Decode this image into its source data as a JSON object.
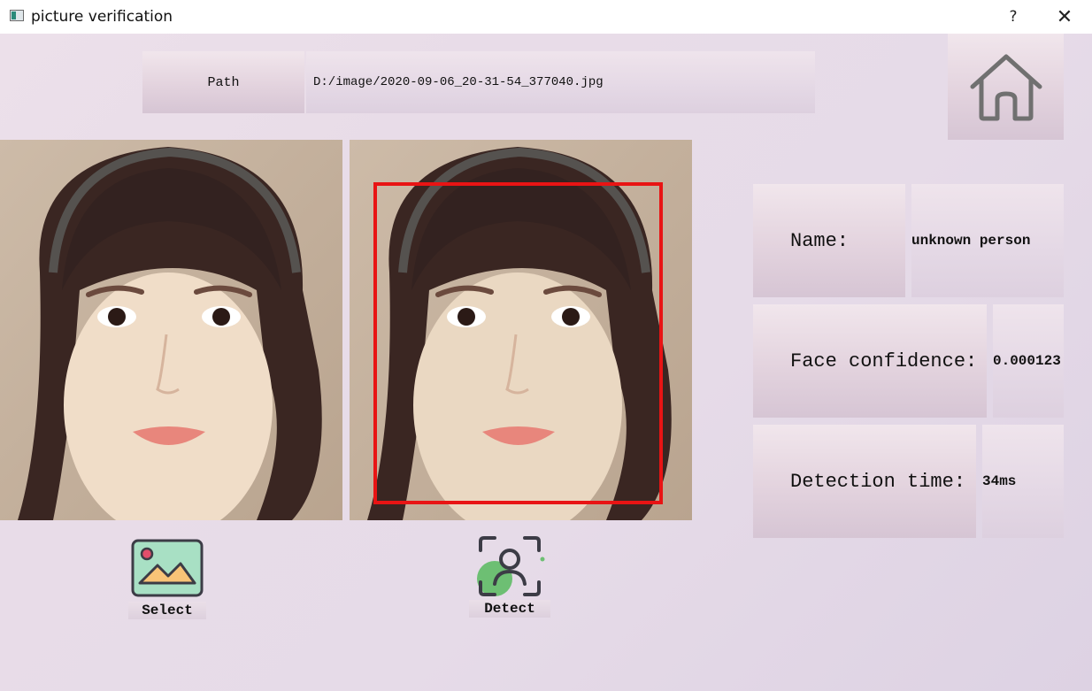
{
  "window": {
    "title": "picture verification",
    "help_label": "?",
    "close_label": "✕"
  },
  "path": {
    "label": "Path",
    "value": "D:/image/2020-09-06_20-31-54_377040.jpg"
  },
  "home_button": {
    "icon": "home-icon"
  },
  "images": {
    "original": "face photo",
    "detected": "face photo with detection box",
    "box_color": "#e81414"
  },
  "actions": {
    "select_label": "Select",
    "detect_label": "Detect"
  },
  "results": {
    "name_label": "Name:",
    "name_value": "unknown person",
    "confidence_label": "Face confidence:",
    "confidence_value": "0.000123",
    "time_label": "Detection time:",
    "time_value": "34ms"
  },
  "colors": {
    "background": "#e8dce8",
    "accent_green": "#6dbf73",
    "accent_pink": "#e24e6b",
    "icon_gray": "#707070"
  }
}
